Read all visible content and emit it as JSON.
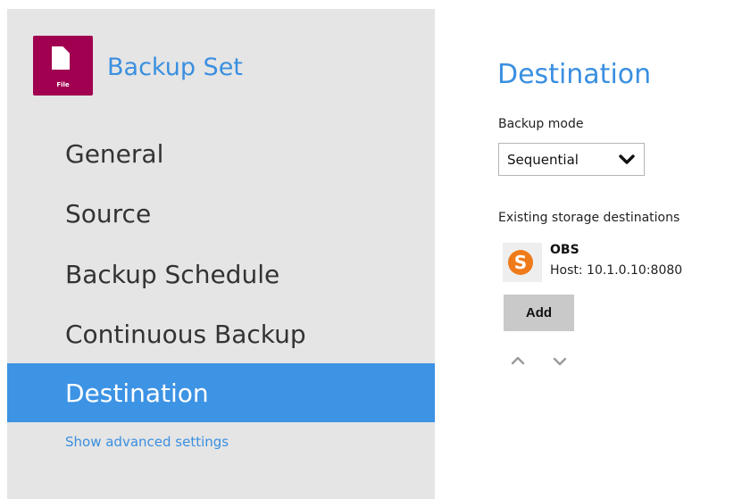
{
  "sidebar": {
    "backup_set_title": "Backup Set",
    "icon_label": "File",
    "nav": [
      {
        "label": "General"
      },
      {
        "label": "Source"
      },
      {
        "label": "Backup Schedule"
      },
      {
        "label": "Continuous Backup"
      },
      {
        "label": "Destination",
        "active": true
      }
    ],
    "advanced_link": "Show advanced settings"
  },
  "main": {
    "title": "Destination",
    "backup_mode_label": "Backup mode",
    "backup_mode_value": "Sequential",
    "existing_label": "Existing storage destinations",
    "destinations": [
      {
        "name": "OBS",
        "host": "Host: 10.1.0.10:8080",
        "icon_letter": "S"
      }
    ],
    "add_label": "Add"
  },
  "colors": {
    "accent": "#3a8fe0",
    "active_nav_bg": "#3d93e4",
    "icon_bg": "#a0004f",
    "obs_orange": "#ef7a1a"
  },
  "icons": [
    "file-document-icon",
    "chevron-down-icon",
    "obs-storage-icon",
    "move-up-icon",
    "move-down-icon"
  ]
}
